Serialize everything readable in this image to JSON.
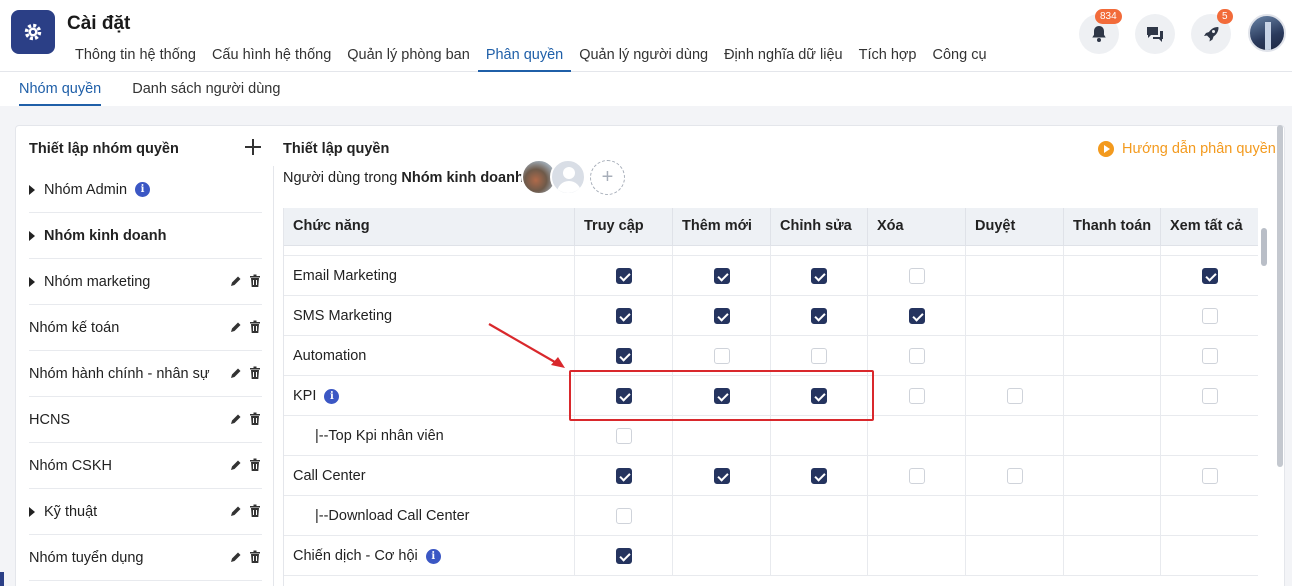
{
  "header": {
    "title": "Cài đặt",
    "nav": [
      {
        "label": "Thông tin hệ thống",
        "active": false
      },
      {
        "label": "Cấu hình hệ thống",
        "active": false
      },
      {
        "label": "Quản lý phòng ban",
        "active": false
      },
      {
        "label": "Phân quyền",
        "active": true
      },
      {
        "label": "Quản lý người dùng",
        "active": false
      },
      {
        "label": "Định nghĩa dữ liệu",
        "active": false
      },
      {
        "label": "Tích hợp",
        "active": false
      },
      {
        "label": "Công cụ",
        "active": false
      }
    ],
    "notifications_count": "834",
    "rocket_count": "5"
  },
  "subtabs": [
    {
      "label": "Nhóm quyền",
      "active": true
    },
    {
      "label": "Danh sách người dùng",
      "active": false
    }
  ],
  "left": {
    "title": "Thiết lập nhóm quyền",
    "groups": [
      {
        "label": "Nhóm Admin"
      },
      {
        "label": "Nhóm kinh doanh"
      },
      {
        "label": "Nhóm marketing"
      },
      {
        "label": "Nhóm kế toán"
      },
      {
        "label": "Nhóm hành chính - nhân sự"
      },
      {
        "label": "HCNS"
      },
      {
        "label": "Nhóm CSKH"
      },
      {
        "label": "Kỹ thuật"
      },
      {
        "label": "Nhóm tuyển dụng"
      }
    ]
  },
  "right": {
    "title": "Thiết lập quyền",
    "guide_label": "Hướng dẫn phân quyền",
    "users_prefix": "Người dùng trong",
    "users_group": "Nhóm kinh doanh:",
    "columns": [
      "Chức năng",
      "Truy cập",
      "Thêm mới",
      "Chỉnh sửa",
      "Xóa",
      "Duyệt",
      "Thanh toán",
      "Xem tất cả"
    ],
    "rows": [
      {
        "name": "Email Marketing",
        "perms": [
          1,
          1,
          1,
          0,
          null,
          null,
          1
        ]
      },
      {
        "name": "SMS Marketing",
        "perms": [
          1,
          1,
          1,
          1,
          null,
          null,
          0
        ]
      },
      {
        "name": "Automation",
        "perms": [
          1,
          0,
          0,
          0,
          null,
          null,
          0
        ]
      },
      {
        "name": "KPI",
        "perms": [
          1,
          1,
          1,
          0,
          0,
          null,
          0
        ]
      },
      {
        "name": "|--Top Kpi nhân viên",
        "perms": [
          0,
          null,
          null,
          null,
          null,
          null,
          null
        ]
      },
      {
        "name": "Call Center",
        "perms": [
          1,
          1,
          1,
          0,
          0,
          null,
          0
        ]
      },
      {
        "name": "|--Download Call Center",
        "perms": [
          0,
          null,
          null,
          null,
          null,
          null,
          null
        ]
      },
      {
        "name": "Chiến dịch - Cơ hội",
        "perms": [
          1,
          null,
          null,
          null,
          null,
          null,
          null
        ]
      }
    ]
  }
}
